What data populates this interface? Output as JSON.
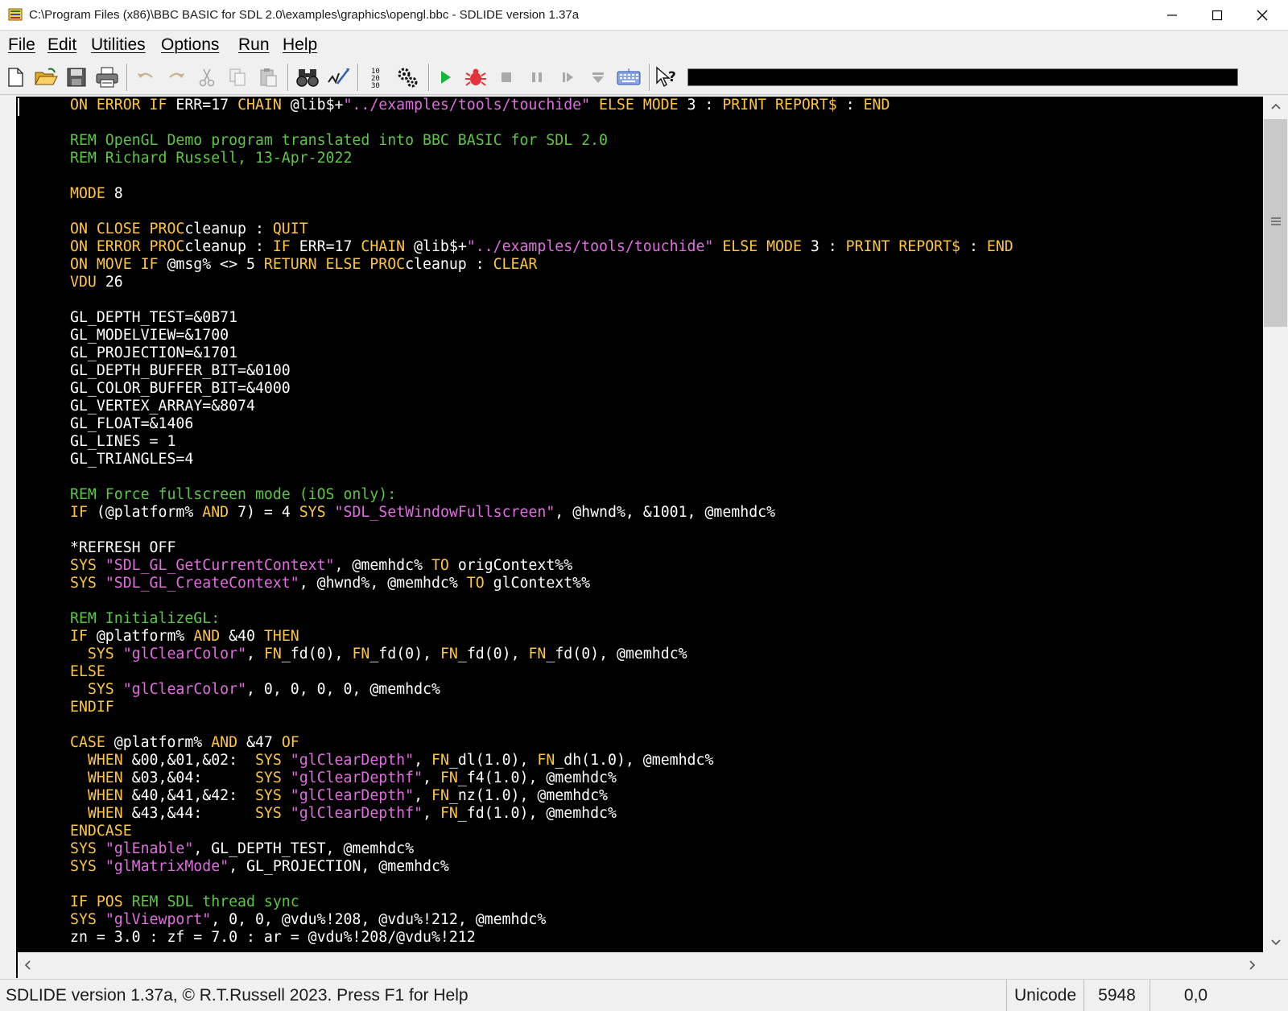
{
  "window": {
    "title": "C:\\Program Files (x86)\\BBC BASIC for SDL 2.0\\examples\\graphics\\opengl.bbc - SDLIDE version 1.37a",
    "app_icon": "bbc-basic-icon",
    "controls": [
      "minimize-icon",
      "maximize-icon",
      "close-icon"
    ]
  },
  "menu": {
    "items": [
      {
        "label": "File"
      },
      {
        "label": "Edit"
      },
      {
        "label": "Utilities"
      },
      {
        "label": "Options"
      },
      {
        "label": "Run"
      },
      {
        "label": "Help"
      }
    ]
  },
  "toolbar": {
    "buttons": [
      "new-file-icon",
      "open-folder-icon",
      "save-icon",
      "print-icon",
      "undo-icon",
      "redo-icon",
      "cut-icon",
      "copy-icon",
      "paste-icon",
      "find-icon",
      "replace-icon",
      "renumber-icon",
      "compile-icon",
      "run-icon",
      "debug-icon",
      "stop-icon",
      "pause-icon",
      "step-icon",
      "step-line-icon",
      "immediate-mode-icon",
      "context-help-icon"
    ],
    "search_value": ""
  },
  "editor": {
    "colors": {
      "keyword": "#ffc63d",
      "string": "#e16ee0",
      "comment": "#5cc645",
      "default": "#ffffff",
      "background": "#000000"
    },
    "lines": [
      [
        [
          "k",
          "ON ERROR IF "
        ],
        [
          "",
          "ERR=17 "
        ],
        [
          "k",
          "CHAIN "
        ],
        [
          "",
          "@lib$+"
        ],
        [
          "s",
          "\"../examples/tools/touchide\""
        ],
        [
          "k",
          " ELSE MODE "
        ],
        [
          "",
          "3 : "
        ],
        [
          "k",
          "PRINT REPORT$ "
        ],
        [
          "",
          ": "
        ],
        [
          "k",
          "END"
        ]
      ],
      [],
      [
        [
          "c",
          "REM OpenGL Demo program translated into BBC BASIC for SDL 2.0"
        ]
      ],
      [
        [
          "c",
          "REM Richard Russell, 13-Apr-2022"
        ]
      ],
      [],
      [
        [
          "k",
          "MODE "
        ],
        [
          "",
          "8"
        ]
      ],
      [],
      [
        [
          "k",
          "ON CLOSE PROC"
        ],
        [
          "",
          "cleanup : "
        ],
        [
          "k",
          "QUIT"
        ]
      ],
      [
        [
          "k",
          "ON ERROR PROC"
        ],
        [
          "",
          "cleanup : "
        ],
        [
          "k",
          "IF "
        ],
        [
          "",
          "ERR=17 "
        ],
        [
          "k",
          "CHAIN "
        ],
        [
          "",
          "@lib$+"
        ],
        [
          "s",
          "\"../examples/tools/touchide\""
        ],
        [
          "k",
          " ELSE MODE "
        ],
        [
          "",
          "3 : "
        ],
        [
          "k",
          "PRINT REPORT$ "
        ],
        [
          "",
          ": "
        ],
        [
          "k",
          "END"
        ]
      ],
      [
        [
          "k",
          "ON MOVE IF "
        ],
        [
          "",
          "@msg% <> 5 "
        ],
        [
          "k",
          "RETURN ELSE PROC"
        ],
        [
          "",
          "cleanup : "
        ],
        [
          "k",
          "CLEAR"
        ]
      ],
      [
        [
          "k",
          "VDU "
        ],
        [
          "",
          "26"
        ]
      ],
      [],
      [
        [
          "",
          "GL_DEPTH_TEST=&0B71"
        ]
      ],
      [
        [
          "",
          "GL_MODELVIEW=&1700"
        ]
      ],
      [
        [
          "",
          "GL_PROJECTION=&1701"
        ]
      ],
      [
        [
          "",
          "GL_DEPTH_BUFFER_BIT=&0100"
        ]
      ],
      [
        [
          "",
          "GL_COLOR_BUFFER_BIT=&4000"
        ]
      ],
      [
        [
          "",
          "GL_VERTEX_ARRAY=&8074"
        ]
      ],
      [
        [
          "",
          "GL_FLOAT=&1406"
        ]
      ],
      [
        [
          "",
          "GL_LINES = 1"
        ]
      ],
      [
        [
          "",
          "GL_TRIANGLES=4"
        ]
      ],
      [],
      [
        [
          "c",
          "REM Force fullscreen mode (iOS only):"
        ]
      ],
      [
        [
          "k",
          "IF "
        ],
        [
          "",
          "(@platform% "
        ],
        [
          "k",
          "AND "
        ],
        [
          "",
          "7) = 4 "
        ],
        [
          "k",
          "SYS "
        ],
        [
          "s",
          "\"SDL_SetWindowFullscreen\""
        ],
        [
          "",
          ", @hwnd%, &1001, @memhdc%"
        ]
      ],
      [],
      [
        [
          "",
          "*REFRESH OFF"
        ]
      ],
      [
        [
          "k",
          "SYS "
        ],
        [
          "s",
          "\"SDL_GL_GetCurrentContext\""
        ],
        [
          "",
          ", @memhdc% "
        ],
        [
          "k",
          "TO "
        ],
        [
          "",
          "origContext%%"
        ]
      ],
      [
        [
          "k",
          "SYS "
        ],
        [
          "s",
          "\"SDL_GL_CreateContext\""
        ],
        [
          "",
          ", @hwnd%, @memhdc% "
        ],
        [
          "k",
          "TO "
        ],
        [
          "",
          "glContext%%"
        ]
      ],
      [],
      [
        [
          "c",
          "REM InitializeGL:"
        ]
      ],
      [
        [
          "k",
          "IF "
        ],
        [
          "",
          "@platform% "
        ],
        [
          "k",
          "AND "
        ],
        [
          "",
          "&40 "
        ],
        [
          "k",
          "THEN"
        ]
      ],
      [
        [
          "",
          "  "
        ],
        [
          "k",
          "SYS "
        ],
        [
          "s",
          "\"glClearColor\""
        ],
        [
          "",
          ", "
        ],
        [
          "k",
          "FN"
        ],
        [
          "",
          "_fd(0), "
        ],
        [
          "k",
          "FN"
        ],
        [
          "",
          "_fd(0), "
        ],
        [
          "k",
          "FN"
        ],
        [
          "",
          "_fd(0), "
        ],
        [
          "k",
          "FN"
        ],
        [
          "",
          "_fd(0), @memhdc%"
        ]
      ],
      [
        [
          "k",
          "ELSE"
        ]
      ],
      [
        [
          "",
          "  "
        ],
        [
          "k",
          "SYS "
        ],
        [
          "s",
          "\"glClearColor\""
        ],
        [
          "",
          ", 0, 0, 0, 0, @memhdc%"
        ]
      ],
      [
        [
          "k",
          "ENDIF"
        ]
      ],
      [],
      [
        [
          "k",
          "CASE "
        ],
        [
          "",
          "@platform% "
        ],
        [
          "k",
          "AND "
        ],
        [
          "",
          "&47 "
        ],
        [
          "k",
          "OF"
        ]
      ],
      [
        [
          "",
          "  "
        ],
        [
          "k",
          "WHEN "
        ],
        [
          "",
          "&00,&01,&02:  "
        ],
        [
          "k",
          "SYS "
        ],
        [
          "s",
          "\"glClearDepth\""
        ],
        [
          "",
          ", "
        ],
        [
          "k",
          "FN"
        ],
        [
          "",
          "_dl(1.0), "
        ],
        [
          "k",
          "FN"
        ],
        [
          "",
          "_dh(1.0), @memhdc%"
        ]
      ],
      [
        [
          "",
          "  "
        ],
        [
          "k",
          "WHEN "
        ],
        [
          "",
          "&03,&04:      "
        ],
        [
          "k",
          "SYS "
        ],
        [
          "s",
          "\"glClearDepthf\""
        ],
        [
          "",
          ", "
        ],
        [
          "k",
          "FN"
        ],
        [
          "",
          "_f4(1.0), @memhdc%"
        ]
      ],
      [
        [
          "",
          "  "
        ],
        [
          "k",
          "WHEN "
        ],
        [
          "",
          "&40,&41,&42:  "
        ],
        [
          "k",
          "SYS "
        ],
        [
          "s",
          "\"glClearDepth\""
        ],
        [
          "",
          ", "
        ],
        [
          "k",
          "FN"
        ],
        [
          "",
          "_nz(1.0), @memhdc%"
        ]
      ],
      [
        [
          "",
          "  "
        ],
        [
          "k",
          "WHEN "
        ],
        [
          "",
          "&43,&44:      "
        ],
        [
          "k",
          "SYS "
        ],
        [
          "s",
          "\"glClearDepthf\""
        ],
        [
          "",
          ", "
        ],
        [
          "k",
          "FN"
        ],
        [
          "",
          "_fd(1.0), @memhdc%"
        ]
      ],
      [
        [
          "k",
          "ENDCASE"
        ]
      ],
      [
        [
          "k",
          "SYS "
        ],
        [
          "s",
          "\"glEnable\""
        ],
        [
          "",
          ", GL_DEPTH_TEST, @memhdc%"
        ]
      ],
      [
        [
          "k",
          "SYS "
        ],
        [
          "s",
          "\"glMatrixMode\""
        ],
        [
          "",
          ", GL_PROJECTION, @memhdc%"
        ]
      ],
      [],
      [
        [
          "k",
          "IF POS "
        ],
        [
          "c",
          "REM SDL thread sync"
        ]
      ],
      [
        [
          "k",
          "SYS "
        ],
        [
          "s",
          "\"glViewport\""
        ],
        [
          "",
          ", 0, 0, @vdu%!208, @vdu%!212, @memhdc%"
        ]
      ],
      [
        [
          "",
          "zn = 3.0 : zf = 7.0 : ar = @vdu%!208/@vdu%!212"
        ]
      ]
    ]
  },
  "scrollbars": {
    "vertical": {
      "up": "chevron-up-icon",
      "down": "chevron-down-icon",
      "thumb_grip": "grip-icon"
    },
    "horizontal": {
      "left": "chevron-left-icon",
      "right": "chevron-right-icon"
    }
  },
  "status": {
    "message": "SDLIDE version 1.37a, © R.T.Russell 2023.  Press F1 for Help",
    "encoding": "Unicode",
    "size": "5948",
    "position": "0,0"
  }
}
